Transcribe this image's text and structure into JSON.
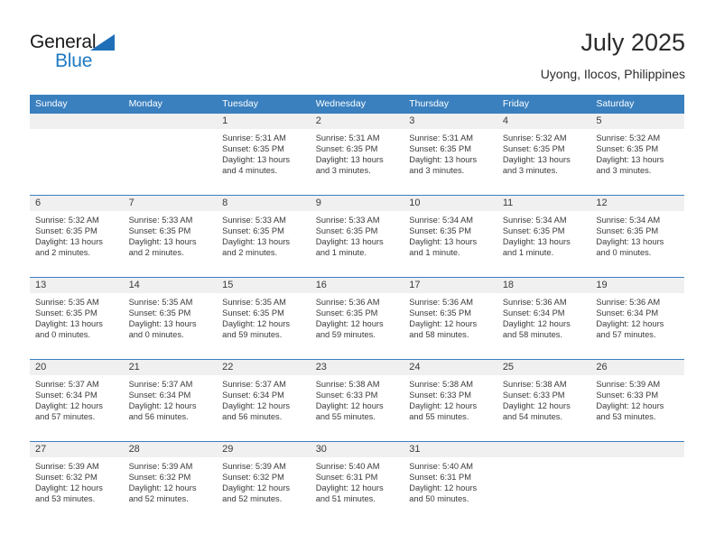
{
  "logo": {
    "primary_text": "General",
    "secondary_text": "Blue",
    "triangle_color": "#1f6fb8",
    "secondary_color": "#1f7ac4"
  },
  "header": {
    "title": "July 2025",
    "location": "Uyong, Ilocos, Philippines"
  },
  "theme": {
    "header_blue": "#3a80bf",
    "day_band_gray": "#f0f0f0",
    "text_color": "#3a3a3a"
  },
  "weekday_headers": [
    "Sunday",
    "Monday",
    "Tuesday",
    "Wednesday",
    "Thursday",
    "Friday",
    "Saturday"
  ],
  "weeks": [
    [
      {
        "day": "",
        "empty": true,
        "sunrise": "",
        "sunset": "",
        "daylight_line1": "",
        "daylight_line2": ""
      },
      {
        "day": "",
        "empty": true,
        "sunrise": "",
        "sunset": "",
        "daylight_line1": "",
        "daylight_line2": ""
      },
      {
        "day": "1",
        "empty": false,
        "sunrise": "Sunrise: 5:31 AM",
        "sunset": "Sunset: 6:35 PM",
        "daylight_line1": "Daylight: 13 hours",
        "daylight_line2": "and 4 minutes."
      },
      {
        "day": "2",
        "empty": false,
        "sunrise": "Sunrise: 5:31 AM",
        "sunset": "Sunset: 6:35 PM",
        "daylight_line1": "Daylight: 13 hours",
        "daylight_line2": "and 3 minutes."
      },
      {
        "day": "3",
        "empty": false,
        "sunrise": "Sunrise: 5:31 AM",
        "sunset": "Sunset: 6:35 PM",
        "daylight_line1": "Daylight: 13 hours",
        "daylight_line2": "and 3 minutes."
      },
      {
        "day": "4",
        "empty": false,
        "sunrise": "Sunrise: 5:32 AM",
        "sunset": "Sunset: 6:35 PM",
        "daylight_line1": "Daylight: 13 hours",
        "daylight_line2": "and 3 minutes."
      },
      {
        "day": "5",
        "empty": false,
        "sunrise": "Sunrise: 5:32 AM",
        "sunset": "Sunset: 6:35 PM",
        "daylight_line1": "Daylight: 13 hours",
        "daylight_line2": "and 3 minutes."
      }
    ],
    [
      {
        "day": "6",
        "empty": false,
        "sunrise": "Sunrise: 5:32 AM",
        "sunset": "Sunset: 6:35 PM",
        "daylight_line1": "Daylight: 13 hours",
        "daylight_line2": "and 2 minutes."
      },
      {
        "day": "7",
        "empty": false,
        "sunrise": "Sunrise: 5:33 AM",
        "sunset": "Sunset: 6:35 PM",
        "daylight_line1": "Daylight: 13 hours",
        "daylight_line2": "and 2 minutes."
      },
      {
        "day": "8",
        "empty": false,
        "sunrise": "Sunrise: 5:33 AM",
        "sunset": "Sunset: 6:35 PM",
        "daylight_line1": "Daylight: 13 hours",
        "daylight_line2": "and 2 minutes."
      },
      {
        "day": "9",
        "empty": false,
        "sunrise": "Sunrise: 5:33 AM",
        "sunset": "Sunset: 6:35 PM",
        "daylight_line1": "Daylight: 13 hours",
        "daylight_line2": "and 1 minute."
      },
      {
        "day": "10",
        "empty": false,
        "sunrise": "Sunrise: 5:34 AM",
        "sunset": "Sunset: 6:35 PM",
        "daylight_line1": "Daylight: 13 hours",
        "daylight_line2": "and 1 minute."
      },
      {
        "day": "11",
        "empty": false,
        "sunrise": "Sunrise: 5:34 AM",
        "sunset": "Sunset: 6:35 PM",
        "daylight_line1": "Daylight: 13 hours",
        "daylight_line2": "and 1 minute."
      },
      {
        "day": "12",
        "empty": false,
        "sunrise": "Sunrise: 5:34 AM",
        "sunset": "Sunset: 6:35 PM",
        "daylight_line1": "Daylight: 13 hours",
        "daylight_line2": "and 0 minutes."
      }
    ],
    [
      {
        "day": "13",
        "empty": false,
        "sunrise": "Sunrise: 5:35 AM",
        "sunset": "Sunset: 6:35 PM",
        "daylight_line1": "Daylight: 13 hours",
        "daylight_line2": "and 0 minutes."
      },
      {
        "day": "14",
        "empty": false,
        "sunrise": "Sunrise: 5:35 AM",
        "sunset": "Sunset: 6:35 PM",
        "daylight_line1": "Daylight: 13 hours",
        "daylight_line2": "and 0 minutes."
      },
      {
        "day": "15",
        "empty": false,
        "sunrise": "Sunrise: 5:35 AM",
        "sunset": "Sunset: 6:35 PM",
        "daylight_line1": "Daylight: 12 hours",
        "daylight_line2": "and 59 minutes."
      },
      {
        "day": "16",
        "empty": false,
        "sunrise": "Sunrise: 5:36 AM",
        "sunset": "Sunset: 6:35 PM",
        "daylight_line1": "Daylight: 12 hours",
        "daylight_line2": "and 59 minutes."
      },
      {
        "day": "17",
        "empty": false,
        "sunrise": "Sunrise: 5:36 AM",
        "sunset": "Sunset: 6:35 PM",
        "daylight_line1": "Daylight: 12 hours",
        "daylight_line2": "and 58 minutes."
      },
      {
        "day": "18",
        "empty": false,
        "sunrise": "Sunrise: 5:36 AM",
        "sunset": "Sunset: 6:34 PM",
        "daylight_line1": "Daylight: 12 hours",
        "daylight_line2": "and 58 minutes."
      },
      {
        "day": "19",
        "empty": false,
        "sunrise": "Sunrise: 5:36 AM",
        "sunset": "Sunset: 6:34 PM",
        "daylight_line1": "Daylight: 12 hours",
        "daylight_line2": "and 57 minutes."
      }
    ],
    [
      {
        "day": "20",
        "empty": false,
        "sunrise": "Sunrise: 5:37 AM",
        "sunset": "Sunset: 6:34 PM",
        "daylight_line1": "Daylight: 12 hours",
        "daylight_line2": "and 57 minutes."
      },
      {
        "day": "21",
        "empty": false,
        "sunrise": "Sunrise: 5:37 AM",
        "sunset": "Sunset: 6:34 PM",
        "daylight_line1": "Daylight: 12 hours",
        "daylight_line2": "and 56 minutes."
      },
      {
        "day": "22",
        "empty": false,
        "sunrise": "Sunrise: 5:37 AM",
        "sunset": "Sunset: 6:34 PM",
        "daylight_line1": "Daylight: 12 hours",
        "daylight_line2": "and 56 minutes."
      },
      {
        "day": "23",
        "empty": false,
        "sunrise": "Sunrise: 5:38 AM",
        "sunset": "Sunset: 6:33 PM",
        "daylight_line1": "Daylight: 12 hours",
        "daylight_line2": "and 55 minutes."
      },
      {
        "day": "24",
        "empty": false,
        "sunrise": "Sunrise: 5:38 AM",
        "sunset": "Sunset: 6:33 PM",
        "daylight_line1": "Daylight: 12 hours",
        "daylight_line2": "and 55 minutes."
      },
      {
        "day": "25",
        "empty": false,
        "sunrise": "Sunrise: 5:38 AM",
        "sunset": "Sunset: 6:33 PM",
        "daylight_line1": "Daylight: 12 hours",
        "daylight_line2": "and 54 minutes."
      },
      {
        "day": "26",
        "empty": false,
        "sunrise": "Sunrise: 5:39 AM",
        "sunset": "Sunset: 6:33 PM",
        "daylight_line1": "Daylight: 12 hours",
        "daylight_line2": "and 53 minutes."
      }
    ],
    [
      {
        "day": "27",
        "empty": false,
        "sunrise": "Sunrise: 5:39 AM",
        "sunset": "Sunset: 6:32 PM",
        "daylight_line1": "Daylight: 12 hours",
        "daylight_line2": "and 53 minutes."
      },
      {
        "day": "28",
        "empty": false,
        "sunrise": "Sunrise: 5:39 AM",
        "sunset": "Sunset: 6:32 PM",
        "daylight_line1": "Daylight: 12 hours",
        "daylight_line2": "and 52 minutes."
      },
      {
        "day": "29",
        "empty": false,
        "sunrise": "Sunrise: 5:39 AM",
        "sunset": "Sunset: 6:32 PM",
        "daylight_line1": "Daylight: 12 hours",
        "daylight_line2": "and 52 minutes."
      },
      {
        "day": "30",
        "empty": false,
        "sunrise": "Sunrise: 5:40 AM",
        "sunset": "Sunset: 6:31 PM",
        "daylight_line1": "Daylight: 12 hours",
        "daylight_line2": "and 51 minutes."
      },
      {
        "day": "31",
        "empty": false,
        "sunrise": "Sunrise: 5:40 AM",
        "sunset": "Sunset: 6:31 PM",
        "daylight_line1": "Daylight: 12 hours",
        "daylight_line2": "and 50 minutes."
      },
      {
        "day": "",
        "empty": true,
        "sunrise": "",
        "sunset": "",
        "daylight_line1": "",
        "daylight_line2": ""
      },
      {
        "day": "",
        "empty": true,
        "sunrise": "",
        "sunset": "",
        "daylight_line1": "",
        "daylight_line2": ""
      }
    ]
  ]
}
